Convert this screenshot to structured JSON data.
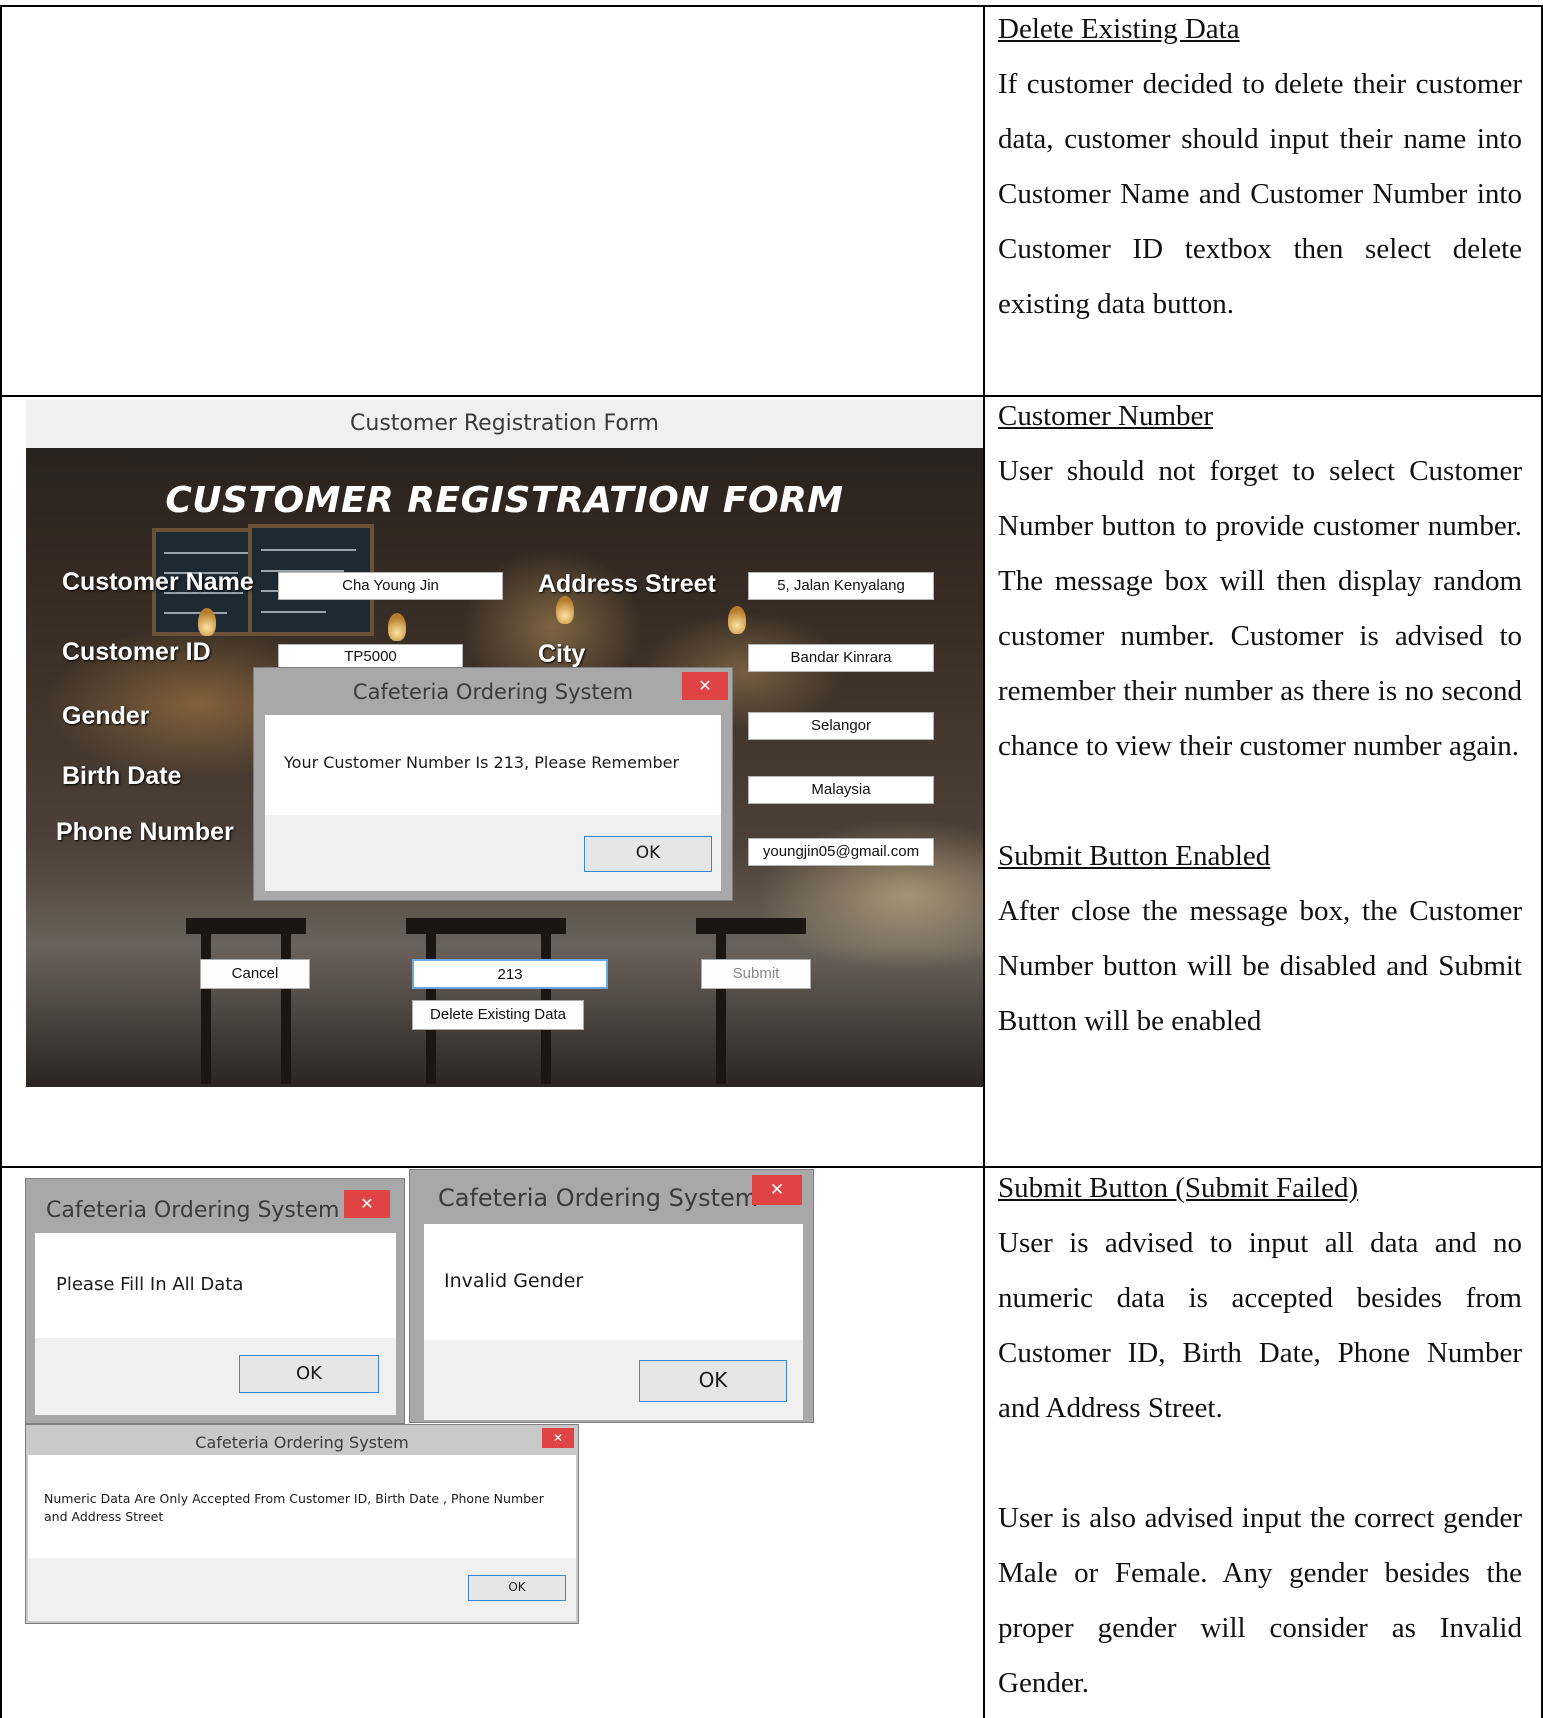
{
  "sections": [
    {
      "heading": "Delete Existing Data",
      "body": "If customer decided to delete their customer data, customer should input their name into Customer Name and Customer Number into Customer ID textbox then select delete existing data button."
    },
    {
      "heading": "Customer  Number",
      "body": "User should not forget to select Customer Number button to provide customer number. The message box will then display random customer number. Customer is advised to remember their number as there is no second chance to view their customer number again.",
      "heading2": "Submit Button Enabled",
      "body2": "After close the message box, the Customer Number button will be disabled and Submit Button will be enabled"
    },
    {
      "heading": "Submit Button (Submit Failed)",
      "body": "User is advised to input all data and no numeric data is accepted besides from Customer ID, Birth Date, Phone Number and Address Street.",
      "body2": "User is also advised input the correct gender Male or Female. Any gender besides the proper gender will consider as Invalid Gender."
    }
  ],
  "registration_window": {
    "title": "Customer Registration Form",
    "heading": "CUSTOMER REGISTRATION FORM",
    "labels": {
      "customer_name": "Customer Name",
      "customer_id": "Customer ID",
      "gender": "Gender",
      "birth_date": "Birth Date",
      "phone_number": "Phone Number",
      "address_street": "Address Street",
      "city": "City"
    },
    "values": {
      "customer_name": "Cha Young Jin",
      "customer_id": "TP5000",
      "address_street": "5, Jalan Kenyalang",
      "city": "Bandar Kinrara",
      "state": "Selangor",
      "country": "Malaysia",
      "email": "youngjin05@gmail.com",
      "customer_number": "213"
    },
    "buttons": {
      "cancel": "Cancel",
      "submit": "Submit",
      "delete": "Delete Existing Data"
    }
  },
  "dialogs": {
    "customer_number": {
      "title": "Cafeteria Ordering System",
      "message": "Your Customer Number Is 213, Please Remember",
      "ok": "OK",
      "close": "✕"
    },
    "fill_all": {
      "title": "Cafeteria Ordering System",
      "message": "Please Fill In All Data",
      "ok": "OK",
      "close": "✕"
    },
    "invalid_gender": {
      "title": "Cafeteria Ordering System",
      "message": "Invalid Gender",
      "ok": "OK",
      "close": "✕"
    },
    "numeric": {
      "title": "Cafeteria Ordering System",
      "message_line1": "Numeric Data Are Only Accepted From Customer ID, Birth Date , Phone Number",
      "message_line2": "and Address Street",
      "ok": "OK",
      "close": "✕"
    }
  },
  "colors": {
    "close_button": "#e04343",
    "ok_border": "#3c87d4",
    "dialog_frame": "#a8a8a8"
  }
}
